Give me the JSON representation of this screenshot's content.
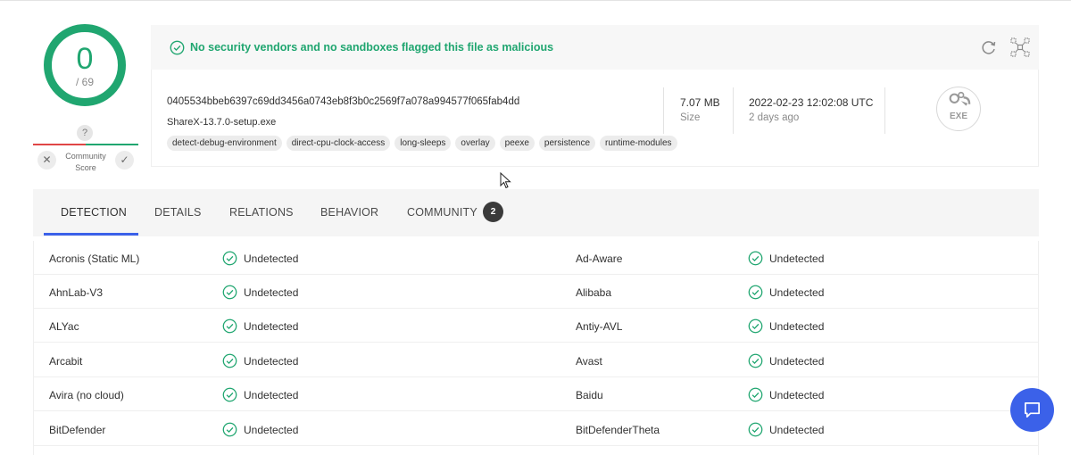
{
  "score": {
    "detected": "0",
    "total": "/ 69"
  },
  "community": {
    "question": "?",
    "label": "Community Score"
  },
  "banner": {
    "message": "No security vendors and no sandboxes flagged this file as malicious"
  },
  "file": {
    "hash": "0405534bbeb6397c69dd3456a0743eb8f3b0c2569f7a078a994577f065fab4dd",
    "name": "ShareX-13.7.0-setup.exe",
    "tags": [
      "detect-debug-environment",
      "direct-cpu-clock-access",
      "long-sleeps",
      "overlay",
      "peexe",
      "persistence",
      "runtime-modules"
    ],
    "size": "7.07 MB",
    "size_label": "Size",
    "date": "2022-02-23 12:02:08 UTC",
    "date_relative": "2 days ago",
    "type_label": "EXE"
  },
  "tabs": [
    {
      "label": "DETECTION"
    },
    {
      "label": "DETAILS"
    },
    {
      "label": "RELATIONS"
    },
    {
      "label": "BEHAVIOR"
    },
    {
      "label": "COMMUNITY",
      "badge": "2"
    }
  ],
  "detections": [
    {
      "left": {
        "vendor": "Acronis (Static ML)",
        "result": "Undetected"
      },
      "right": {
        "vendor": "Ad-Aware",
        "result": "Undetected"
      }
    },
    {
      "left": {
        "vendor": "AhnLab-V3",
        "result": "Undetected"
      },
      "right": {
        "vendor": "Alibaba",
        "result": "Undetected"
      }
    },
    {
      "left": {
        "vendor": "ALYac",
        "result": "Undetected"
      },
      "right": {
        "vendor": "Antiy-AVL",
        "result": "Undetected"
      }
    },
    {
      "left": {
        "vendor": "Arcabit",
        "result": "Undetected"
      },
      "right": {
        "vendor": "Avast",
        "result": "Undetected"
      }
    },
    {
      "left": {
        "vendor": "Avira (no cloud)",
        "result": "Undetected"
      },
      "right": {
        "vendor": "Baidu",
        "result": "Undetected"
      }
    },
    {
      "left": {
        "vendor": "BitDefender",
        "result": "Undetected"
      },
      "right": {
        "vendor": "BitDefenderTheta",
        "result": "Undetected"
      }
    }
  ],
  "colors": {
    "accent": "#3b61e9",
    "success": "#20a670",
    "danger": "#e04646"
  }
}
